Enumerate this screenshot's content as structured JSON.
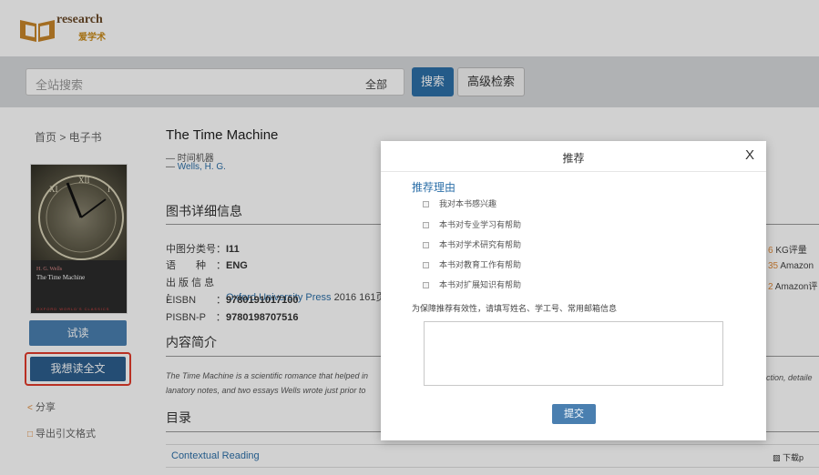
{
  "header": {
    "logo_text": "research",
    "logo_sub": "爱学术"
  },
  "search": {
    "placeholder": "全站搜索",
    "scope": "全部",
    "search_label": "搜索",
    "advanced_label": "高级检索"
  },
  "left": {
    "breadcrumb": "首页 > 电子书",
    "cover_author": "H. G. Wells",
    "cover_title": "The Time Machine",
    "cover_publisher": "OXFORD WORLD'S CLASSICS",
    "trial_label": "试读",
    "fulltext_label": "我想读全文",
    "share_label": "分享",
    "cite_label": "导出引文格式"
  },
  "book": {
    "title": "The Time Machine",
    "alt_title": "— 时间机器",
    "author_prefix": "— ",
    "author": "Wells, H. G.",
    "detail_heading": "图书详细信息",
    "meta": [
      {
        "label": "中图分类号：",
        "value": "I11"
      },
      {
        "label": "语　　种　：",
        "value": "ENG"
      },
      {
        "label": "出 版 信 息 ：",
        "link": "Oxford University Press",
        "value": " 2016 161页"
      },
      {
        "label": "EISBN　　：",
        "value": "9780191017100"
      },
      {
        "label": "PISBN-P　：",
        "value": "9780198707516"
      }
    ],
    "intro_heading": "内容简介",
    "abstract_line1": "The Time Machine is a scientific romance that helped in",
    "abstract_line2": "lanatory notes, and two essays Wells wrote just prior to",
    "abstract_right": "uction, detaile",
    "toc_heading": "目录",
    "toc_first": "Contextual Reading",
    "download_label": "下载p"
  },
  "ratings": [
    {
      "num": "6",
      "label": "KG评量"
    },
    {
      "num": "35",
      "label": "Amazon"
    },
    {
      "num": "2",
      "label": "Amazon评"
    }
  ],
  "modal": {
    "title": "推荐",
    "close": "X",
    "reason_title": "推荐理由",
    "options": [
      "我对本书感兴趣",
      "本书对专业学习有帮助",
      "本书对学术研究有帮助",
      "本书对教育工作有帮助",
      "本书对扩展知识有帮助"
    ],
    "hint": "为保障推荐有效性，请填写姓名、学工号、常用邮箱信息",
    "submit_label": "提交"
  }
}
